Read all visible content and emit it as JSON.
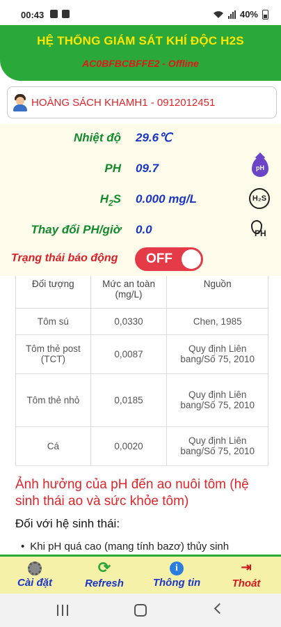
{
  "status_bar": {
    "time": "00:43",
    "battery": "40%"
  },
  "header": {
    "title": "HỆ THỐNG GIÁM SÁT KHÍ ĐỘC H2S",
    "device_line": "AC0BFBCBFFE2 - Offline"
  },
  "user": {
    "name": "HOÀNG SÁCH KHAMH1 - 0912012451"
  },
  "readings": {
    "temperature": {
      "label": "Nhiệt độ",
      "value": "29.6℃"
    },
    "ph": {
      "label": "PH",
      "value": "09.7",
      "icon": "ph-drop-icon"
    },
    "h2s": {
      "label_main": "H",
      "label_sub": "2",
      "label_end": "S",
      "value": "0.000 mg/L",
      "icon": "h2s-icon"
    },
    "ph_change": {
      "label": "Thay đổi PH/giờ",
      "value": "0.0",
      "icon": "ph-change-icon"
    }
  },
  "alarm": {
    "label": "Trạng thái báo động",
    "toggle_text": "OFF",
    "state": false
  },
  "icon_text": {
    "ph": "pH",
    "h2s": "H₂S",
    "ph_change": "PH"
  },
  "table": {
    "headers": [
      "Đối tượng",
      "Mức an toàn (mg/L)",
      "Nguồn"
    ],
    "rows": [
      [
        "Tôm sú",
        "0,0330",
        "Chen, 1985"
      ],
      [
        "Tôm thẻ post (TCT)",
        "0,0087",
        "Quy định Liên bang/Số 75, 2010"
      ],
      [
        "Tôm thẻ nhỏ",
        "0,0185",
        "Quy định Liên bang/Số 75, 2010"
      ],
      [
        "Cá",
        "0,0020",
        "Quy định Liên bang/Số 75, 2010"
      ]
    ]
  },
  "article": {
    "title": "Ảnh hưởng của pH đến ao nuôi tôm (hệ sinh thái ao và sức khỏe tôm)",
    "section": "Đối với hệ sinh thái:",
    "bullet": "Khi pH quá cao (mang tính bazơ) thủy sinh"
  },
  "bottom_nav": {
    "items": [
      {
        "label": "Cài đặt",
        "icon": "settings-icon",
        "color": "#1a35c7"
      },
      {
        "label": "Refresh",
        "icon": "refresh-icon",
        "color": "#1a35c7"
      },
      {
        "label": "Thông tin",
        "icon": "info-icon",
        "color": "#1a35c7"
      },
      {
        "label": "Thoát",
        "icon": "logout-icon",
        "color": "#d01a20"
      }
    ]
  },
  "colors": {
    "header_bg": "#2aa83a",
    "title": "#ffe600",
    "alarm_off": "#e53b48",
    "label_green": "#138a2c",
    "value_blue": "#1a35c7"
  }
}
